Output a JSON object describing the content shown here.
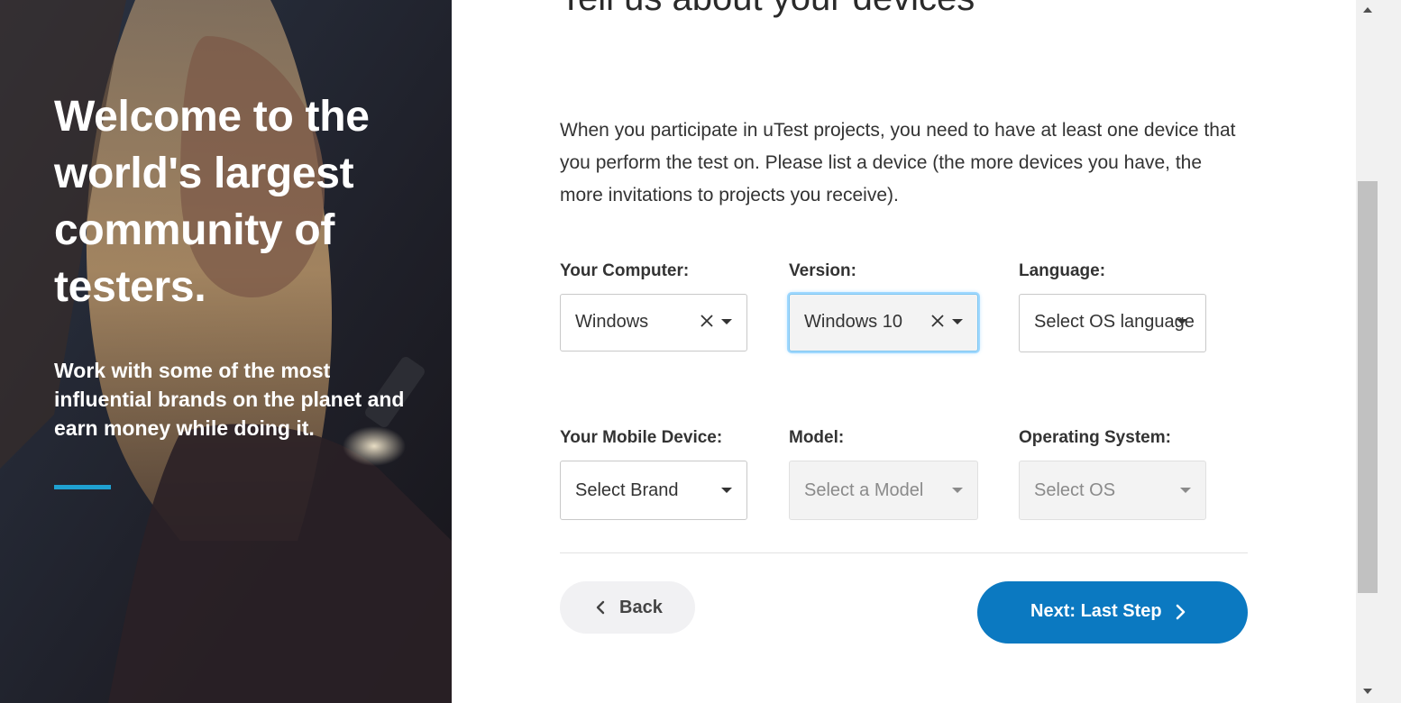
{
  "hero": {
    "title": "Welcome to the world's largest community of testers.",
    "subtitle": "Work with some of the most influential brands on the planet and earn money while doing it.",
    "accent_color": "#1fa1d1"
  },
  "form": {
    "heading": "Tell us about your devices",
    "intro": "When you participate in uTest projects, you need to have at least one device that you perform the test on. Please list a device (the more devices you have, the more invitations to projects you receive).",
    "computer": {
      "label": "Your Computer:",
      "value": "Windows"
    },
    "version": {
      "label": "Version:",
      "value": "Windows 10"
    },
    "language": {
      "label": "Language:",
      "placeholder": "Select OS language"
    },
    "mobile_device": {
      "label": "Your Mobile Device:",
      "placeholder": "Select Brand"
    },
    "model": {
      "label": "Model:",
      "placeholder": "Select a Model"
    },
    "operating_system": {
      "label": "Operating System:",
      "placeholder": "Select OS"
    },
    "back_label": "Back",
    "next_label": "Next: Last Step",
    "primary_color": "#0b79c1"
  },
  "icons": {
    "clear": "close-icon",
    "dropdown": "caret-down-icon",
    "back": "chevron-left-icon",
    "next": "chevron-right-icon"
  }
}
